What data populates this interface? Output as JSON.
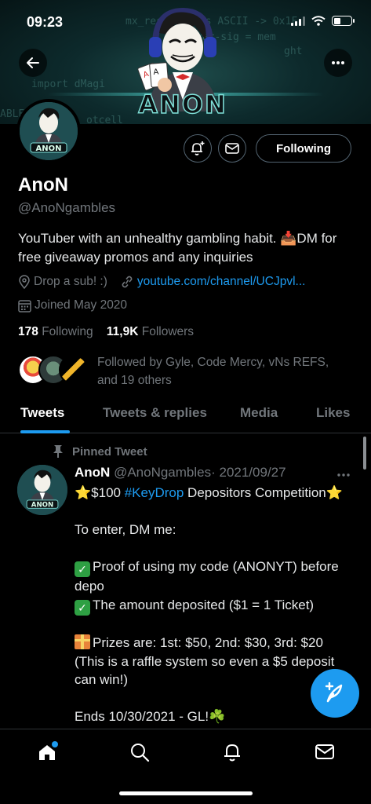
{
  "status_bar": {
    "time": "09:23"
  },
  "banner": {
    "logo_text": "ANON",
    "code_lines": [
      "mx_reset Flags ASCII -> 0x1F",
      "var-sig = mem",
      "ght",
      "import dMagi",
      "ABLE",
      "otcell"
    ]
  },
  "profile": {
    "name": "AnoN",
    "handle": "@AnoNgambles",
    "bio": "YouTuber with an unhealthy gambling habit. 📥DM for free giveaway promos and any inquiries",
    "location": "Drop a sub! :)",
    "website": "youtube.com/channel/UCJpvl...",
    "joined": "Joined May 2020",
    "following_count": "178",
    "following_label": "Following",
    "followers_count": "11,9K",
    "followers_label": "Followers",
    "followed_by": "Followed by Gyle, Code Mercy, vNs REFS, and 19 others"
  },
  "actions": {
    "following_button": "Following"
  },
  "tabs": [
    {
      "label": "Tweets"
    },
    {
      "label": "Tweets & replies"
    },
    {
      "label": "Media"
    },
    {
      "label": "Likes"
    }
  ],
  "tweet": {
    "pinned_label": "Pinned Tweet",
    "author_name": "AnoN",
    "author_handle": "@AnoNgambles",
    "date": "· 2021/09/27",
    "line1_pre": "⭐$100 ",
    "hashtag": "#KeyDrop",
    "line1_post": " Depositors Competition⭐",
    "line2": "To enter, DM me:",
    "line3": "Proof of using my code (ANONYT) before depo",
    "line4": "The amount deposited ($1 = 1 Ticket)",
    "line5": "Prizes are: 1st: $50, 2nd: $30, 3rd: $20",
    "line6": "(This is a raffle system so even a $5 deposit can win!)",
    "line7": "Ends 10/30/2021 - GL!☘️"
  },
  "colors": {
    "accent": "#1d9bf0",
    "muted": "#71767b",
    "border": "#2f3336",
    "background": "#000000"
  },
  "icons": [
    "back-arrow-icon",
    "more-icon",
    "bell-plus-icon",
    "mail-icon",
    "location-pin-icon",
    "link-icon",
    "calendar-icon",
    "pin-icon",
    "compose-icon",
    "home-icon",
    "search-icon",
    "bell-icon",
    "envelope-icon"
  ]
}
